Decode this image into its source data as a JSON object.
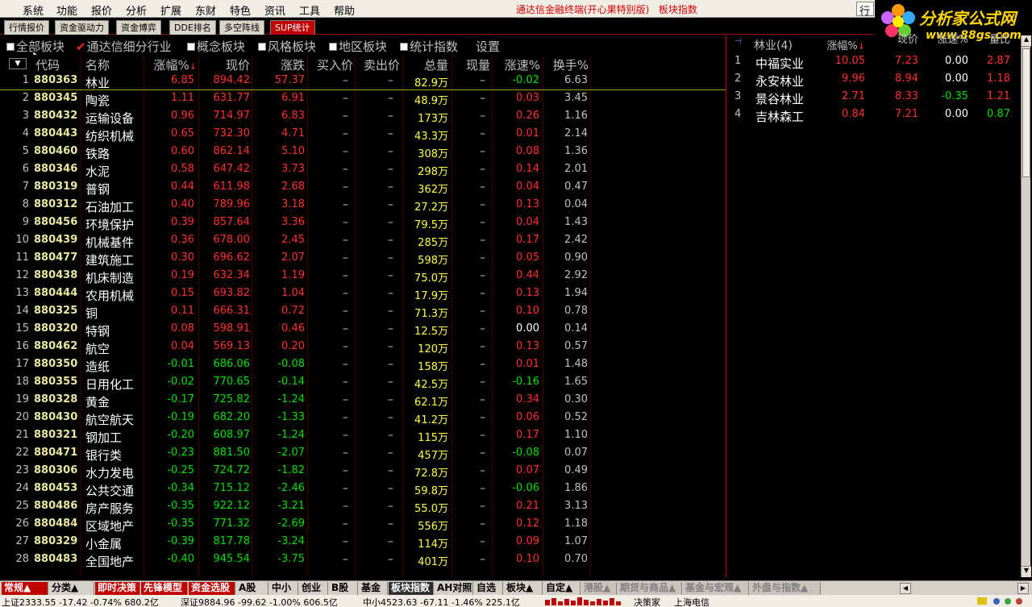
{
  "menubar": {
    "items": [
      "系统",
      "功能",
      "报价",
      "分析",
      "扩展",
      "东财",
      "特色",
      "资讯",
      "工具",
      "帮助"
    ],
    "app_title": "通达信金融终端(开心果特别版)",
    "app_section": "板块指数",
    "ctl_text": "行"
  },
  "logo": {
    "cn_text": "分析家公式网",
    "url_text": "www.88gs.com"
  },
  "tabs": [
    "行情报价",
    "资金驱动力",
    "资金博弈",
    "DDE排名",
    "多空阵线",
    "SUP统计"
  ],
  "filters": [
    {
      "label": "全部板块",
      "checked": false
    },
    {
      "label": "通达信细分行业",
      "checked": true
    },
    {
      "label": "概念板块",
      "checked": false
    },
    {
      "label": "风格板块",
      "checked": false
    },
    {
      "label": "地区板块",
      "checked": false
    },
    {
      "label": "统计指数",
      "checked": false
    }
  ],
  "settings_label": "设置",
  "columns": {
    "code": "代码",
    "name": "名称",
    "chg": "涨幅%",
    "chg_sort": "↓",
    "price": "现价",
    "diff": "涨跌",
    "bid": "买入价",
    "ask": "卖出价",
    "vol": "总量",
    "cur": "现量",
    "spd": "涨速%",
    "turn": "换手%"
  },
  "rows": [
    {
      "idx": "1",
      "code": "880363",
      "name": "林业",
      "chg": "6.85",
      "price": "894.42",
      "diff": "57.37",
      "bid": "–",
      "ask": "–",
      "vol": "82.9万",
      "cur": "–",
      "spd": "-0.02",
      "turn": "6.63"
    },
    {
      "idx": "2",
      "code": "880345",
      "name": "陶瓷",
      "chg": "1.11",
      "price": "631.77",
      "diff": "6.91",
      "bid": "–",
      "ask": "–",
      "vol": "48.9万",
      "cur": "–",
      "spd": "0.03",
      "turn": "3.45"
    },
    {
      "idx": "3",
      "code": "880432",
      "name": "运输设备",
      "chg": "0.96",
      "price": "714.97",
      "diff": "6.83",
      "bid": "–",
      "ask": "–",
      "vol": "173万",
      "cur": "–",
      "spd": "0.26",
      "turn": "1.16"
    },
    {
      "idx": "4",
      "code": "880443",
      "name": "纺织机械",
      "chg": "0.65",
      "price": "732.30",
      "diff": "4.71",
      "bid": "–",
      "ask": "–",
      "vol": "43.3万",
      "cur": "–",
      "spd": "0.01",
      "turn": "2.14"
    },
    {
      "idx": "5",
      "code": "880460",
      "name": "铁路",
      "chg": "0.60",
      "price": "862.14",
      "diff": "5.10",
      "bid": "–",
      "ask": "–",
      "vol": "308万",
      "cur": "–",
      "spd": "0.08",
      "turn": "1.36"
    },
    {
      "idx": "6",
      "code": "880346",
      "name": "水泥",
      "chg": "0.58",
      "price": "647.42",
      "diff": "3.73",
      "bid": "–",
      "ask": "–",
      "vol": "298万",
      "cur": "–",
      "spd": "0.14",
      "turn": "2.01"
    },
    {
      "idx": "7",
      "code": "880319",
      "name": "普钢",
      "chg": "0.44",
      "price": "611.98",
      "diff": "2.68",
      "bid": "–",
      "ask": "–",
      "vol": "362万",
      "cur": "–",
      "spd": "0.04",
      "turn": "0.47"
    },
    {
      "idx": "8",
      "code": "880312",
      "name": "石油加工",
      "chg": "0.40",
      "price": "789.96",
      "diff": "3.18",
      "bid": "–",
      "ask": "–",
      "vol": "27.2万",
      "cur": "–",
      "spd": "0.13",
      "turn": "0.04"
    },
    {
      "idx": "9",
      "code": "880456",
      "name": "环境保护",
      "chg": "0.39",
      "price": "857.64",
      "diff": "3.36",
      "bid": "–",
      "ask": "–",
      "vol": "79.5万",
      "cur": "–",
      "spd": "0.04",
      "turn": "1.43"
    },
    {
      "idx": "10",
      "code": "880439",
      "name": "机械基件",
      "chg": "0.36",
      "price": "678.00",
      "diff": "2.45",
      "bid": "–",
      "ask": "–",
      "vol": "285万",
      "cur": "–",
      "spd": "0.17",
      "turn": "2.42"
    },
    {
      "idx": "11",
      "code": "880477",
      "name": "建筑施工",
      "chg": "0.30",
      "price": "696.62",
      "diff": "2.07",
      "bid": "–",
      "ask": "–",
      "vol": "598万",
      "cur": "–",
      "spd": "0.05",
      "turn": "0.90"
    },
    {
      "idx": "12",
      "code": "880438",
      "name": "机床制造",
      "chg": "0.19",
      "price": "632.34",
      "diff": "1.19",
      "bid": "–",
      "ask": "–",
      "vol": "75.0万",
      "cur": "–",
      "spd": "0.44",
      "turn": "2.92"
    },
    {
      "idx": "13",
      "code": "880444",
      "name": "农用机械",
      "chg": "0.15",
      "price": "693.82",
      "diff": "1.04",
      "bid": "–",
      "ask": "–",
      "vol": "17.9万",
      "cur": "–",
      "spd": "0.13",
      "turn": "1.94"
    },
    {
      "idx": "14",
      "code": "880325",
      "name": "铜",
      "chg": "0.11",
      "price": "666.31",
      "diff": "0.72",
      "bid": "–",
      "ask": "–",
      "vol": "71.3万",
      "cur": "–",
      "spd": "0.10",
      "turn": "0.78"
    },
    {
      "idx": "15",
      "code": "880320",
      "name": "特钢",
      "chg": "0.08",
      "price": "598.91",
      "diff": "0.46",
      "bid": "–",
      "ask": "–",
      "vol": "12.5万",
      "cur": "–",
      "spd": "0.00",
      "turn": "0.14"
    },
    {
      "idx": "16",
      "code": "880462",
      "name": "航空",
      "chg": "0.04",
      "price": "569.13",
      "diff": "0.20",
      "bid": "–",
      "ask": "–",
      "vol": "120万",
      "cur": "–",
      "spd": "0.13",
      "turn": "0.57"
    },
    {
      "idx": "17",
      "code": "880350",
      "name": "造纸",
      "chg": "-0.01",
      "price": "686.06",
      "diff": "-0.08",
      "bid": "–",
      "ask": "–",
      "vol": "158万",
      "cur": "–",
      "spd": "0.01",
      "turn": "1.48"
    },
    {
      "idx": "18",
      "code": "880355",
      "name": "日用化工",
      "chg": "-0.02",
      "price": "770.65",
      "diff": "-0.14",
      "bid": "–",
      "ask": "–",
      "vol": "42.5万",
      "cur": "–",
      "spd": "-0.16",
      "turn": "1.65"
    },
    {
      "idx": "19",
      "code": "880328",
      "name": "黄金",
      "chg": "-0.17",
      "price": "725.82",
      "diff": "-1.24",
      "bid": "–",
      "ask": "–",
      "vol": "62.1万",
      "cur": "–",
      "spd": "0.34",
      "turn": "0.30"
    },
    {
      "idx": "20",
      "code": "880430",
      "name": "航空航天",
      "chg": "-0.19",
      "price": "682.20",
      "diff": "-1.33",
      "bid": "–",
      "ask": "–",
      "vol": "41.2万",
      "cur": "–",
      "spd": "0.06",
      "turn": "0.52"
    },
    {
      "idx": "21",
      "code": "880321",
      "name": "钢加工",
      "chg": "-0.20",
      "price": "608.97",
      "diff": "-1.24",
      "bid": "–",
      "ask": "–",
      "vol": "115万",
      "cur": "–",
      "spd": "0.17",
      "turn": "1.10"
    },
    {
      "idx": "22",
      "code": "880471",
      "name": "银行类",
      "chg": "-0.23",
      "price": "881.50",
      "diff": "-2.07",
      "bid": "–",
      "ask": "–",
      "vol": "457万",
      "cur": "–",
      "spd": "-0.08",
      "turn": "0.07"
    },
    {
      "idx": "23",
      "code": "880306",
      "name": "水力发电",
      "chg": "-0.25",
      "price": "724.72",
      "diff": "-1.82",
      "bid": "–",
      "ask": "–",
      "vol": "72.8万",
      "cur": "–",
      "spd": "0.07",
      "turn": "0.49"
    },
    {
      "idx": "24",
      "code": "880453",
      "name": "公共交通",
      "chg": "-0.34",
      "price": "715.12",
      "diff": "-2.46",
      "bid": "–",
      "ask": "–",
      "vol": "59.8万",
      "cur": "–",
      "spd": "-0.06",
      "turn": "1.86"
    },
    {
      "idx": "25",
      "code": "880486",
      "name": "房产服务",
      "chg": "-0.35",
      "price": "922.12",
      "diff": "-3.21",
      "bid": "–",
      "ask": "–",
      "vol": "55.0万",
      "cur": "–",
      "spd": "0.21",
      "turn": "3.13"
    },
    {
      "idx": "26",
      "code": "880484",
      "name": "区域地产",
      "chg": "-0.35",
      "price": "771.32",
      "diff": "-2.69",
      "bid": "–",
      "ask": "–",
      "vol": "556万",
      "cur": "–",
      "spd": "0.12",
      "turn": "1.18"
    },
    {
      "idx": "27",
      "code": "880329",
      "name": "小金属",
      "chg": "-0.39",
      "price": "817.78",
      "diff": "-3.24",
      "bid": "–",
      "ask": "–",
      "vol": "114万",
      "cur": "–",
      "spd": "0.09",
      "turn": "1.07"
    },
    {
      "idx": "28",
      "code": "880483",
      "name": "全国地产",
      "chg": "-0.40",
      "price": "945.54",
      "diff": "-3.75",
      "bid": "–",
      "ask": "–",
      "vol": "401万",
      "cur": "–",
      "spd": "0.10",
      "turn": "0.70"
    }
  ],
  "right_panel": {
    "header": {
      "title": "林业(4)",
      "chg": "涨幅%",
      "chg_sort": "↓",
      "price": "现价",
      "spd": "涨速%",
      "ratio": "量比"
    },
    "rows": [
      {
        "idx": "1",
        "name": "中福实业",
        "chg": "10.05",
        "price": "7.23",
        "spd": "0.00",
        "ratio": "2.87"
      },
      {
        "idx": "2",
        "name": "永安林业",
        "chg": "9.96",
        "price": "8.94",
        "spd": "0.00",
        "ratio": "1.18"
      },
      {
        "idx": "3",
        "name": "景谷林业",
        "chg": "2.71",
        "price": "8.33",
        "spd": "-0.35",
        "ratio": "1.21"
      },
      {
        "idx": "4",
        "name": "吉林森工",
        "chg": "0.84",
        "price": "7.21",
        "spd": "0.00",
        "ratio": "0.87"
      }
    ]
  },
  "bottom_tabs": [
    {
      "label": "常规▲",
      "style": "red"
    },
    {
      "label": "分类▲",
      "style": "gray"
    },
    {
      "label": "即时决策",
      "style": "red"
    },
    {
      "label": "先锋模型",
      "style": "red"
    },
    {
      "label": "资金选股",
      "style": "red"
    },
    {
      "label": "A股",
      "style": "gray"
    },
    {
      "label": "中小",
      "style": "gray"
    },
    {
      "label": "创业",
      "style": "gray"
    },
    {
      "label": "B股",
      "style": "gray"
    },
    {
      "label": "基金",
      "style": "gray"
    },
    {
      "label": "板块指数",
      "style": "dark"
    },
    {
      "label": "AH对照",
      "style": "gray"
    },
    {
      "label": "自选",
      "style": "gray"
    },
    {
      "label": "板块▲",
      "style": "gray"
    },
    {
      "label": "自定▲",
      "style": "gray"
    },
    {
      "label": "港股▲",
      "style": "tan"
    },
    {
      "label": "期货与商品▲",
      "style": "tan"
    },
    {
      "label": "基金与宏观▲",
      "style": "tan"
    },
    {
      "label": "外盘与指数▲",
      "style": "tan"
    }
  ],
  "status": {
    "sh": "上证2333.55 -17.42 -0.74% 680.2亿",
    "sz": "深证9884.96 -99.62 -1.00% 606.5亿",
    "zx": "中小4523.63 -67.11 -1.46% 225.1亿",
    "decision": "决策家",
    "isp": "上海电信"
  },
  "colors": {
    "up": "#ff3030",
    "down": "#00e000",
    "flat": "#ffffff",
    "volume": "#ffff40",
    "code": "#e8e8a0"
  }
}
